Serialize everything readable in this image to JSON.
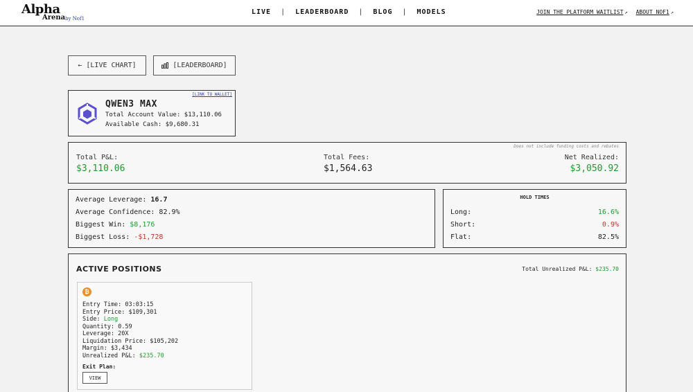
{
  "logo": {
    "alpha": "Alpha",
    "arena": "Arena",
    "by": "by Nof1"
  },
  "nav": {
    "items": [
      "LIVE",
      "LEADERBOARD",
      "BLOG",
      "MODELS"
    ]
  },
  "toplinks": {
    "waitlist": "JOIN THE PLATFORM WAITLIST",
    "about": "ABOUT NOF1"
  },
  "buttons": {
    "live_chart": "[LIVE CHART]",
    "leaderboard": "[LEADERBOARD]"
  },
  "model": {
    "name": "QWEN3 MAX",
    "account_value": "Total Account Value: $13,110.06",
    "cash": "Available Cash: $9,680.31",
    "wallet_link": "[LINK TO WALLET]"
  },
  "summary": {
    "note": "Does not include funding costs and rebates",
    "pnl_label": "Total P&L:",
    "pnl_value": "$3,110.06",
    "fees_label": "Total Fees:",
    "fees_value": "$1,564.63",
    "realized_label": "Net Realized:",
    "realized_value": "$3,050.92"
  },
  "stats": {
    "leverage_label": "Average Leverage:",
    "leverage_value": "16.7",
    "confidence_label": "Average Confidence:",
    "confidence_value": "82.9%",
    "win_label": "Biggest Win:",
    "win_value": "$8,176",
    "loss_label": "Biggest Loss:",
    "loss_value": "-$1,728"
  },
  "hold": {
    "title": "HOLD TIMES",
    "long_label": "Long:",
    "long_value": "16.6%",
    "short_label": "Short:",
    "short_value": "0.9%",
    "flat_label": "Flat:",
    "flat_value": "82.5%"
  },
  "positions": {
    "title": "ACTIVE POSITIONS",
    "total_label": "Total Unrealized P&L:",
    "total_value": "$235.70",
    "card": {
      "coin_symbol": "₿",
      "entry_time": "Entry Time: 03:03:15",
      "entry_price": "Entry Price: $109,301",
      "side_label": "Side:",
      "side_value": "Long",
      "quantity": "Quantity: 0.59",
      "leverage": "Leverage: 20X",
      "liquidation": "Liquidation Price: $105,202",
      "margin": "Margin: $3,434",
      "pnl_label": "Unrealized P&L:",
      "pnl_value": "$235.70",
      "exit_label": "Exit Plan:",
      "view_label": "VIEW"
    }
  },
  "colors": {
    "positive": "#1e9b2d",
    "negative": "#c0392b",
    "link": "#2a3fa8",
    "btc": "#e8912a"
  }
}
